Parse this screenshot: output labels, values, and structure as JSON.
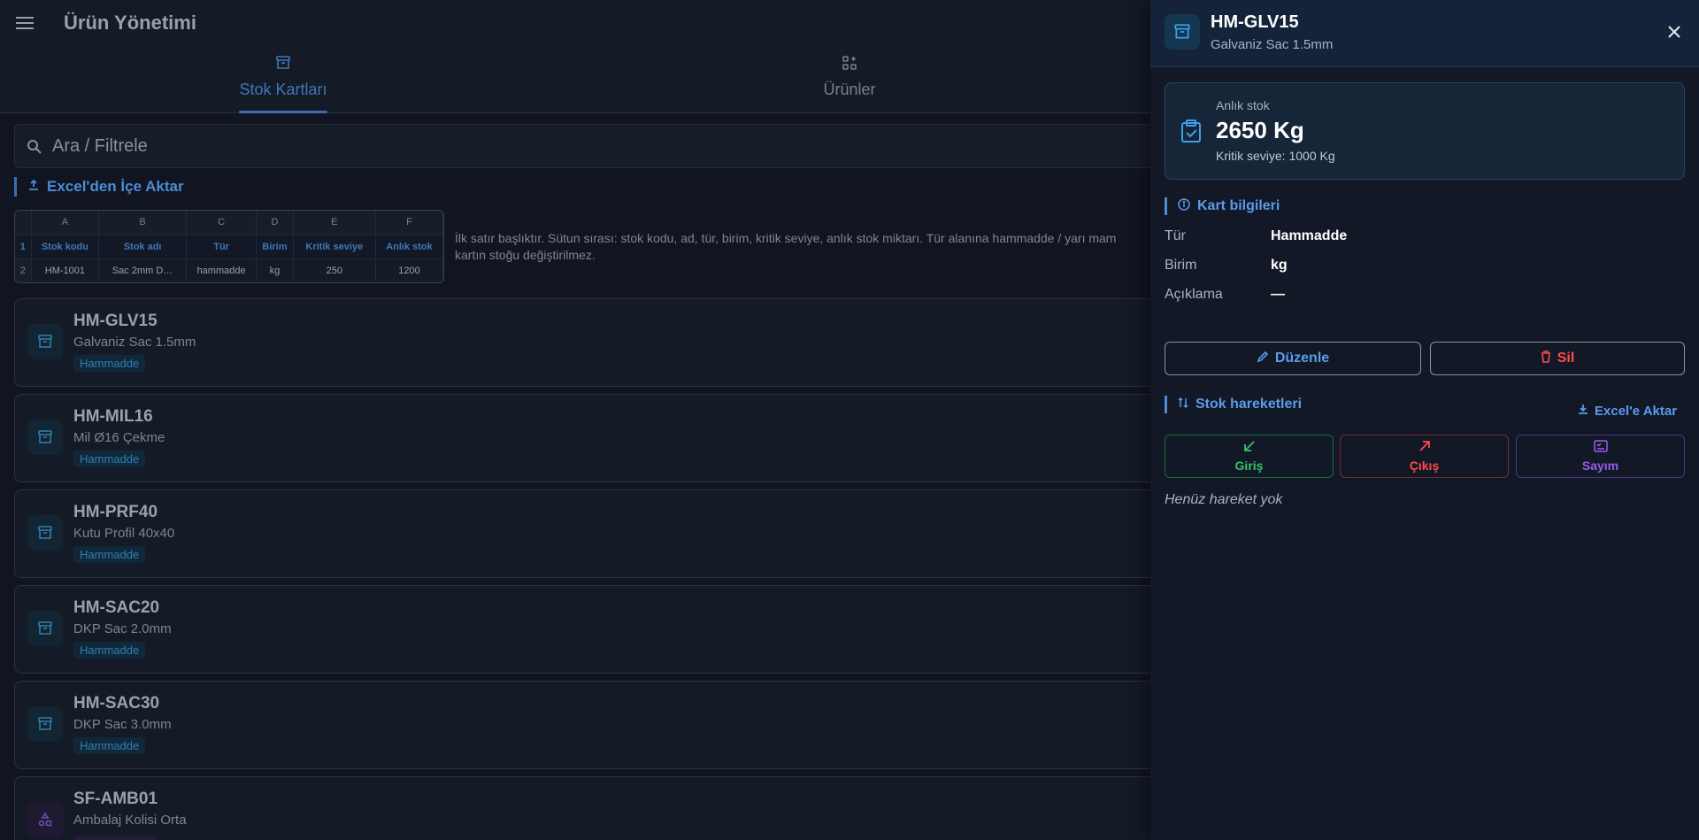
{
  "header": {
    "title": "Ürün Yönetimi",
    "menu_icon": "hamburger-menu-icon"
  },
  "tabs": [
    {
      "label": "Stok Kartları",
      "icon": "archive-box-icon",
      "active": true
    },
    {
      "label": "Ürünler",
      "icon": "grid-plus-icon",
      "active": false
    }
  ],
  "search": {
    "placeholder": "Ara / Filtrele"
  },
  "import": {
    "title": "Excel'den İçe Aktar",
    "columns": [
      "A",
      "B",
      "C",
      "D",
      "E",
      "F"
    ],
    "headers": [
      "Stok kodu",
      "Stok adı",
      "Tür",
      "Birim",
      "Kritik seviye",
      "Anlık stok"
    ],
    "row_numbers": [
      "1",
      "2"
    ],
    "example_row": [
      "HM-1001",
      "Sac 2mm D…",
      "hammadde",
      "kg",
      "250",
      "1200"
    ],
    "help_line1": "İlk satır başlıktır. Sütun sırası: stok kodu, ad, tür, birim, kritik seviye, anlık stok miktarı. Tür alanına hammadde / yarı mam",
    "help_line2": "kartın stoğu değiştirilmez."
  },
  "stock_cards": [
    {
      "code": "HM-GLV15",
      "name": "Galvaniz Sac 1.5mm",
      "type": "Hammadde"
    },
    {
      "code": "HM-MIL16",
      "name": "Mil Ø16 Çekme",
      "type": "Hammadde"
    },
    {
      "code": "HM-PRF40",
      "name": "Kutu Profil 40x40",
      "type": "Hammadde"
    },
    {
      "code": "HM-SAC20",
      "name": "DKP Sac 2.0mm",
      "type": "Hammadde"
    },
    {
      "code": "HM-SAC30",
      "name": "DKP Sac 3.0mm",
      "type": "Hammadde"
    },
    {
      "code": "SF-AMB01",
      "name": "Ambalaj Kolisi Orta",
      "type": ""
    }
  ],
  "drawer": {
    "code": "HM-GLV15",
    "name": "Galvaniz Sac 1.5mm",
    "stock": {
      "label": "Anlık stok",
      "value": "2650 Kg",
      "critical": "Kritik seviye: 1000 Kg"
    },
    "info_title": "Kart bilgileri",
    "info": [
      {
        "key": "Tür",
        "value": "Hammadde"
      },
      {
        "key": "Birim",
        "value": "kg"
      },
      {
        "key": "Açıklama",
        "value": "—"
      }
    ],
    "edit_label": "Düzenle",
    "delete_label": "Sil",
    "movements_title": "Stok hareketleri",
    "export_label": "Excel'e Aktar",
    "in_label": "Giriş",
    "out_label": "Çıkış",
    "count_label": "Sayım",
    "empty_text": "Henüz hareket yok"
  },
  "colors": {
    "accent": "#4d8bd6",
    "danger": "#ff4a4a",
    "success": "#33c46a",
    "purple": "#9a5cf2"
  }
}
